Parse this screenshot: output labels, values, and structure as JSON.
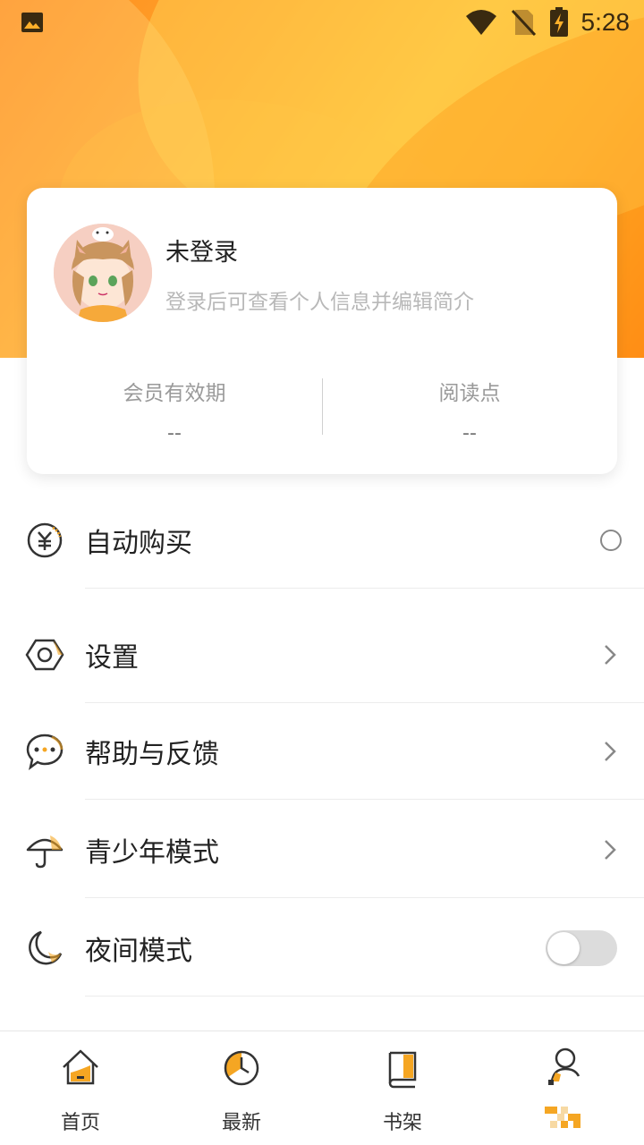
{
  "status_bar": {
    "time": "5:28",
    "icons": [
      "image-icon",
      "wifi-icon",
      "no-sim-icon",
      "battery-charging-icon"
    ]
  },
  "profile": {
    "name": "未登录",
    "subtitle": "登录后可查看个人信息并编辑简介",
    "stats": [
      {
        "label": "会员有效期",
        "value": "--"
      },
      {
        "label": "阅读点",
        "value": "--"
      }
    ]
  },
  "menu": {
    "items": [
      {
        "label": "自动购买",
        "icon": "coin-icon",
        "control": "radio"
      },
      {
        "label": "设置",
        "icon": "hex-nut-icon",
        "control": "chevron"
      },
      {
        "label": "帮助与反馈",
        "icon": "chat-bubble-icon",
        "control": "chevron"
      },
      {
        "label": "青少年模式",
        "icon": "umbrella-icon",
        "control": "chevron"
      },
      {
        "label": "夜间模式",
        "icon": "moon-icon",
        "control": "toggle",
        "toggle_on": false
      }
    ]
  },
  "bottom_nav": {
    "items": [
      {
        "label": "首页",
        "icon": "home-icon"
      },
      {
        "label": "最新",
        "icon": "clock-icon"
      },
      {
        "label": "书架",
        "icon": "book-icon"
      },
      {
        "label": "",
        "icon": "profile-icon",
        "active": true
      }
    ]
  },
  "colors": {
    "accent": "#f5a623",
    "header_start": "#ff8a1e",
    "header_mid": "#ffbe34"
  }
}
